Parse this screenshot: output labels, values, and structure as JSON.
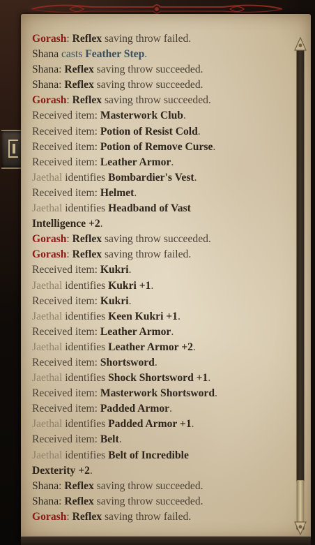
{
  "log": [
    [
      {
        "t": "Gorash",
        "c": "red"
      },
      {
        "t": ": ",
        "c": "plain"
      },
      {
        "t": "Reflex",
        "c": "bold"
      },
      {
        "t": " saving throw failed.",
        "c": "plain"
      }
    ],
    [
      {
        "t": "Shana",
        "c": "name"
      },
      {
        "t": " casts ",
        "c": "blue"
      },
      {
        "t": "Feather Step",
        "c": "spell"
      },
      {
        "t": ".",
        "c": "blue"
      }
    ],
    [
      {
        "t": "Shana",
        "c": "name"
      },
      {
        "t": ": ",
        "c": "plain"
      },
      {
        "t": "Reflex",
        "c": "bold"
      },
      {
        "t": " saving throw succeeded.",
        "c": "plain"
      }
    ],
    [
      {
        "t": "Shana",
        "c": "name"
      },
      {
        "t": ": ",
        "c": "plain"
      },
      {
        "t": "Reflex",
        "c": "bold"
      },
      {
        "t": " saving throw succeeded.",
        "c": "plain"
      }
    ],
    [
      {
        "t": "Gorash",
        "c": "red"
      },
      {
        "t": ": ",
        "c": "plain"
      },
      {
        "t": "Reflex",
        "c": "bold"
      },
      {
        "t": " saving throw succeeded.",
        "c": "plain"
      }
    ],
    [
      {
        "t": "Received item: ",
        "c": "plain"
      },
      {
        "t": "Masterwork Club",
        "c": "bold"
      },
      {
        "t": ".",
        "c": "plain"
      }
    ],
    [
      {
        "t": "Received item: ",
        "c": "plain"
      },
      {
        "t": "Potion of Resist Cold",
        "c": "bold"
      },
      {
        "t": ".",
        "c": "plain"
      }
    ],
    [
      {
        "t": "Received item: ",
        "c": "plain"
      },
      {
        "t": "Potion of Remove Curse",
        "c": "bold"
      },
      {
        "t": ".",
        "c": "plain"
      }
    ],
    [
      {
        "t": "Received item: ",
        "c": "plain"
      },
      {
        "t": "Leather Armor",
        "c": "bold"
      },
      {
        "t": ".",
        "c": "plain"
      }
    ],
    [
      {
        "t": "Jaethal",
        "c": "jae"
      },
      {
        "t": " identifies ",
        "c": "plain"
      },
      {
        "t": "Bombardier's Vest",
        "c": "bold"
      },
      {
        "t": ".",
        "c": "plain"
      }
    ],
    [
      {
        "t": "Received item: ",
        "c": "plain"
      },
      {
        "t": "Helmet",
        "c": "bold"
      },
      {
        "t": ".",
        "c": "plain"
      }
    ],
    [
      {
        "t": "Jaethal",
        "c": "jae"
      },
      {
        "t": " identifies ",
        "c": "plain"
      },
      {
        "t": "Headband of Vast",
        "c": "bold"
      }
    ],
    [
      {
        "t": "Intelligence +2",
        "c": "bold"
      },
      {
        "t": ".",
        "c": "plain"
      }
    ],
    [
      {
        "t": "Gorash",
        "c": "red"
      },
      {
        "t": ": ",
        "c": "plain"
      },
      {
        "t": "Reflex",
        "c": "bold"
      },
      {
        "t": " saving throw succeeded.",
        "c": "plain"
      }
    ],
    [
      {
        "t": "Gorash",
        "c": "red"
      },
      {
        "t": ": ",
        "c": "plain"
      },
      {
        "t": "Reflex",
        "c": "bold"
      },
      {
        "t": " saving throw failed.",
        "c": "plain"
      }
    ],
    [
      {
        "t": "Received item: ",
        "c": "plain"
      },
      {
        "t": "Kukri",
        "c": "bold"
      },
      {
        "t": ".",
        "c": "plain"
      }
    ],
    [
      {
        "t": "Jaethal",
        "c": "jae"
      },
      {
        "t": " identifies ",
        "c": "plain"
      },
      {
        "t": "Kukri +1",
        "c": "bold"
      },
      {
        "t": ".",
        "c": "plain"
      }
    ],
    [
      {
        "t": "Received item: ",
        "c": "plain"
      },
      {
        "t": "Kukri",
        "c": "bold"
      },
      {
        "t": ".",
        "c": "plain"
      }
    ],
    [
      {
        "t": "Jaethal",
        "c": "jae"
      },
      {
        "t": " identifies ",
        "c": "plain"
      },
      {
        "t": "Keen Kukri +1",
        "c": "bold"
      },
      {
        "t": ".",
        "c": "plain"
      }
    ],
    [
      {
        "t": "Received item: ",
        "c": "plain"
      },
      {
        "t": "Leather Armor",
        "c": "bold"
      },
      {
        "t": ".",
        "c": "plain"
      }
    ],
    [
      {
        "t": "Jaethal",
        "c": "jae"
      },
      {
        "t": " identifies ",
        "c": "plain"
      },
      {
        "t": "Leather Armor +2",
        "c": "bold"
      },
      {
        "t": ".",
        "c": "plain"
      }
    ],
    [
      {
        "t": "Received item: ",
        "c": "plain"
      },
      {
        "t": "Shortsword",
        "c": "bold"
      },
      {
        "t": ".",
        "c": "plain"
      }
    ],
    [
      {
        "t": "Jaethal",
        "c": "jae"
      },
      {
        "t": " identifies ",
        "c": "plain"
      },
      {
        "t": "Shock Shortsword +1",
        "c": "bold"
      },
      {
        "t": ".",
        "c": "plain"
      }
    ],
    [
      {
        "t": "Received item: ",
        "c": "plain"
      },
      {
        "t": "Masterwork Shortsword",
        "c": "bold"
      },
      {
        "t": ".",
        "c": "plain"
      }
    ],
    [
      {
        "t": "Received item: ",
        "c": "plain"
      },
      {
        "t": "Padded Armor",
        "c": "bold"
      },
      {
        "t": ".",
        "c": "plain"
      }
    ],
    [
      {
        "t": "Jaethal",
        "c": "jae"
      },
      {
        "t": " identifies ",
        "c": "plain"
      },
      {
        "t": "Padded Armor +1",
        "c": "bold"
      },
      {
        "t": ".",
        "c": "plain"
      }
    ],
    [
      {
        "t": "Received item: ",
        "c": "plain"
      },
      {
        "t": "Belt",
        "c": "bold"
      },
      {
        "t": ".",
        "c": "plain"
      }
    ],
    [
      {
        "t": "Jaethal",
        "c": "jae"
      },
      {
        "t": " identifies ",
        "c": "plain"
      },
      {
        "t": "Belt of Incredible",
        "c": "bold"
      }
    ],
    [
      {
        "t": "Dexterity +2",
        "c": "bold"
      },
      {
        "t": ".",
        "c": "plain"
      }
    ],
    [
      {
        "t": "Shana",
        "c": "name"
      },
      {
        "t": ": ",
        "c": "plain"
      },
      {
        "t": "Reflex",
        "c": "bold"
      },
      {
        "t": " saving throw succeeded.",
        "c": "plain"
      }
    ],
    [
      {
        "t": "Shana",
        "c": "name"
      },
      {
        "t": ": ",
        "c": "plain"
      },
      {
        "t": "Reflex",
        "c": "bold"
      },
      {
        "t": " saving throw succeeded.",
        "c": "plain"
      }
    ],
    [
      {
        "t": "Gorash",
        "c": "red"
      },
      {
        "t": ": ",
        "c": "plain"
      },
      {
        "t": "Reflex",
        "c": "bold"
      },
      {
        "t": " saving throw failed.",
        "c": "plain"
      }
    ]
  ],
  "icons": {
    "side_tab": "journal-toggle-icon",
    "top_ornament": "ornament-icon",
    "scroll_up": "scroll-up-cap-icon",
    "scroll_down": "scroll-down-cap-icon"
  },
  "colors": {
    "character_red": "#8a1a16",
    "jaethal_tan": "#8f8268",
    "spell_blue": "#3a4e5c",
    "parchment": "#d9ccb2"
  },
  "scroll": {
    "position_fraction": 1.0
  }
}
